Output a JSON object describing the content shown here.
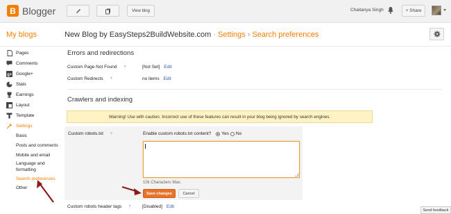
{
  "app": {
    "name": "Blogger",
    "logo_letter": "B"
  },
  "toolbar": {
    "view_blog": "View blog",
    "share": "+ Share",
    "user_name": "Chaitanya Singh"
  },
  "header": {
    "my_blogs": "My blogs",
    "blog_name": "New Blog by EasySteps2BuildWebsite.com",
    "separator1": "·",
    "section": "Settings",
    "separator2": "›",
    "page": "Search preferences"
  },
  "sidebar": {
    "items": [
      {
        "label": "Pages",
        "icon": "pages-icon"
      },
      {
        "label": "Comments",
        "icon": "comments-icon"
      },
      {
        "label": "Google+",
        "icon": "google-plus-icon"
      },
      {
        "label": "Stats",
        "icon": "stats-icon"
      },
      {
        "label": "Earnings",
        "icon": "earnings-icon"
      },
      {
        "label": "Layout",
        "icon": "layout-icon"
      },
      {
        "label": "Template",
        "icon": "template-icon"
      },
      {
        "label": "Settings",
        "icon": "wrench-icon"
      }
    ],
    "settings_sub": [
      {
        "label": "Basic"
      },
      {
        "label": "Posts and comments"
      },
      {
        "label": "Mobile and email"
      },
      {
        "label": "Language and formatting"
      },
      {
        "label": "Search preferences"
      },
      {
        "label": "Other"
      }
    ]
  },
  "errors": {
    "title": "Errors and redirections",
    "page_not_found": {
      "label": "Custom Page Not Found",
      "value": "[Not Set]",
      "edit": "Edit"
    },
    "redirects": {
      "label": "Custom Redirects",
      "value": "no items",
      "edit": "Edit"
    }
  },
  "crawlers": {
    "title": "Crawlers and indexing",
    "warning": "Warning! Use with caution. Incorrect use of these features can result in your blog being ignored by search engines.",
    "robots": {
      "label": "Custom robots.txt",
      "enable_question": "Enable custom robots.txt content?",
      "yes": "Yes",
      "no": "No",
      "textarea_value": "",
      "max_note": "10k Characters Max.",
      "save": "Save changes",
      "cancel": "Cancel"
    },
    "header_tags": {
      "label": "Custom robots header tags",
      "value": "[Disabled]",
      "edit": "Edit"
    }
  },
  "help_glyph": "?",
  "feedback": "Send feedback",
  "colors": {
    "accent": "#f57d00",
    "link": "#2a5db0",
    "annotation_arrow": "#8b1a1a"
  }
}
